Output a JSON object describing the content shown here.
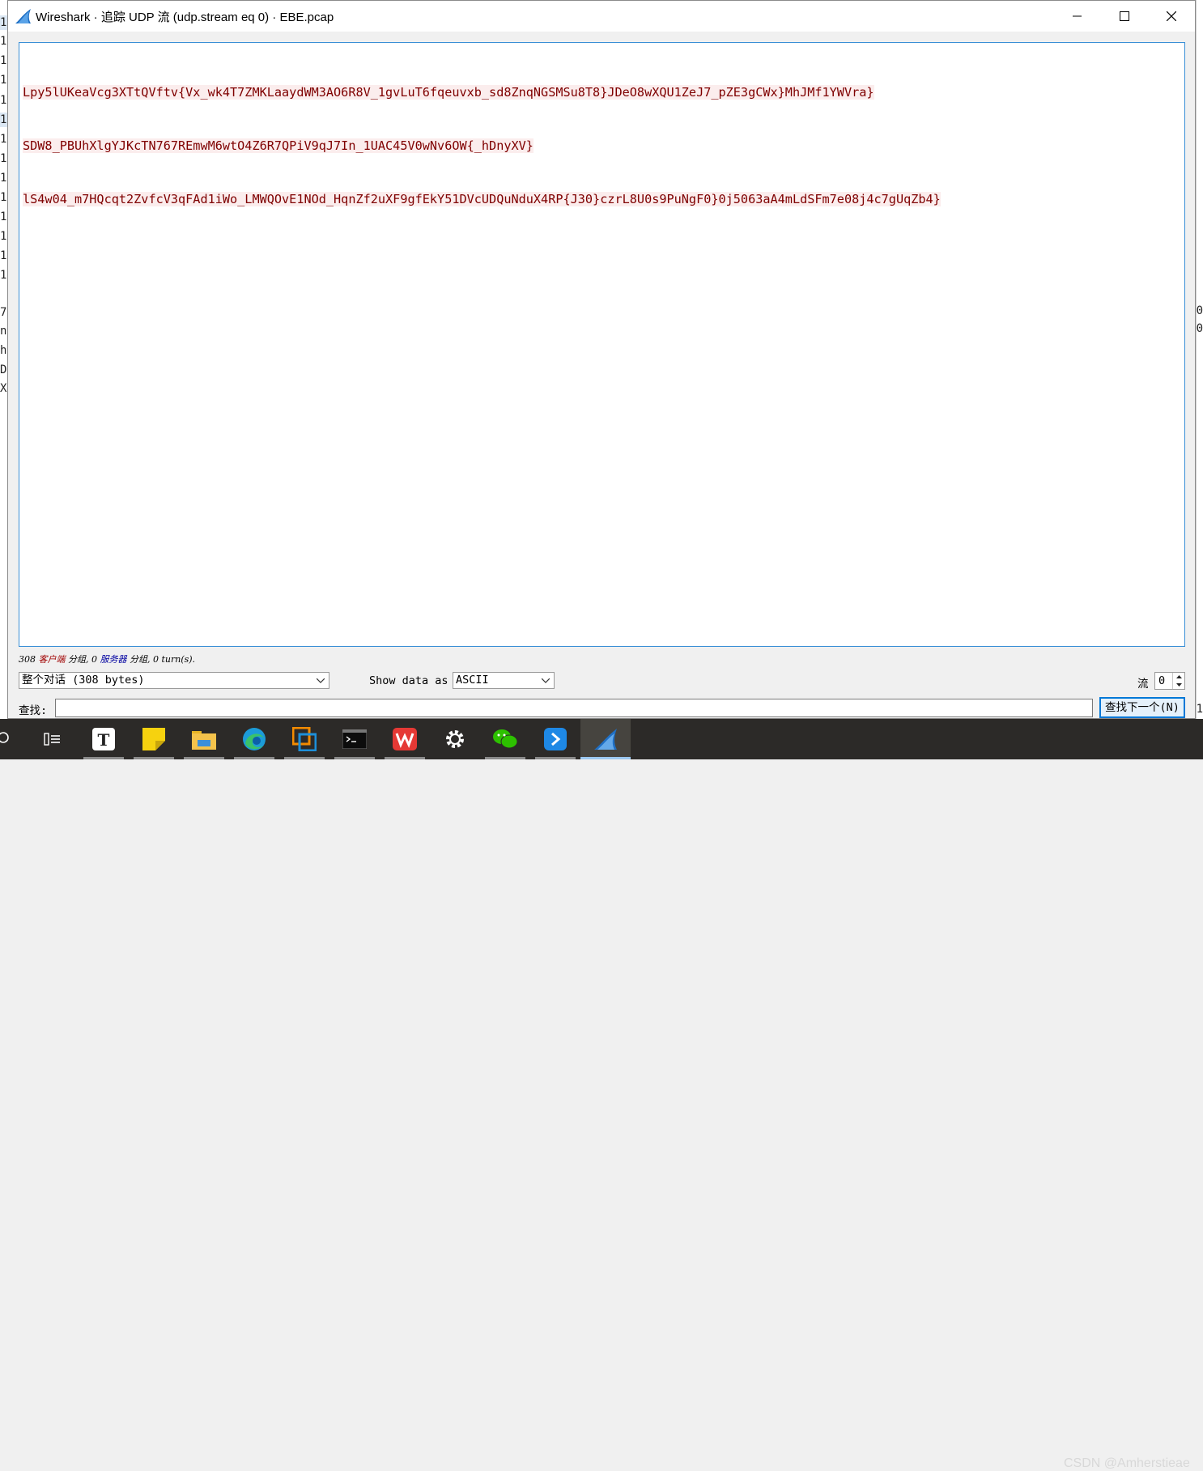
{
  "window": {
    "title": "Wireshark · 追踪 UDP 流 (udp.stream eq 0) · EBE.pcap"
  },
  "stream": {
    "lines": [
      "Lpy5lUKeaVcg3XTtQVftv{Vx_wk4T7ZMKLaaydWM3AO6R8V_1gvLuT6fqeuvxb_sd8ZnqNGSMSu8T8}JDeO8wXQU1ZeJ7_pZE3gCWx}MhJMf1YWVra}",
      "SDW8_PBUhXlgYJKcTN767REmwM6wtO4Z6R7QPiV9qJ7In_1UAC45V0wNv6OW{_hDnyXV}",
      "lS4w04_m7HQcqt2ZvfcV3qFAd1iWo_LMWQOvE1NOd_HqnZf2uXF9gfEkY51DVcUDQuNduX4RP{J30}czrL8U0s9PuNgF0}0j5063aA4mLdSFm7e08j4c7gUqZb4}"
    ],
    "client_color": "#7f0000"
  },
  "stats": {
    "prefix": "308 ",
    "client": "客户端",
    "mid1": " 分组, 0 ",
    "server": "服务器",
    "suffix": " 分组, 0 turn(s)."
  },
  "controls": {
    "conversation_select": "整个对话 (308 bytes)",
    "show_data_label": "Show data as",
    "show_data_select": "ASCII",
    "stream_label": "流",
    "stream_value": "0",
    "find_label": "查找:",
    "find_value": "",
    "find_next_button": "查找下一个(N)"
  },
  "background": {
    "left_digits": [
      "1",
      "1",
      "1",
      "1",
      "1",
      "1",
      "1",
      "1",
      "1",
      "1",
      "1",
      "1",
      "1",
      "1",
      "1",
      "1"
    ],
    "left_lower": [
      "7",
      "ne",
      "he",
      "Da",
      "X:"
    ],
    "right_digits": [
      "0",
      "0"
    ],
    "right_bottom": "1"
  },
  "taskbar": {
    "items": [
      "search-icon",
      "task-view-icon",
      "typora-icon",
      "sticky-notes-icon",
      "file-explorer-icon",
      "edge-icon",
      "vmware-icon",
      "terminal-icon",
      "wps-icon",
      "settings-icon",
      "wechat-icon",
      "feishu-icon",
      "wireshark-icon"
    ],
    "watermark": "CSDN @Amherstieae"
  }
}
